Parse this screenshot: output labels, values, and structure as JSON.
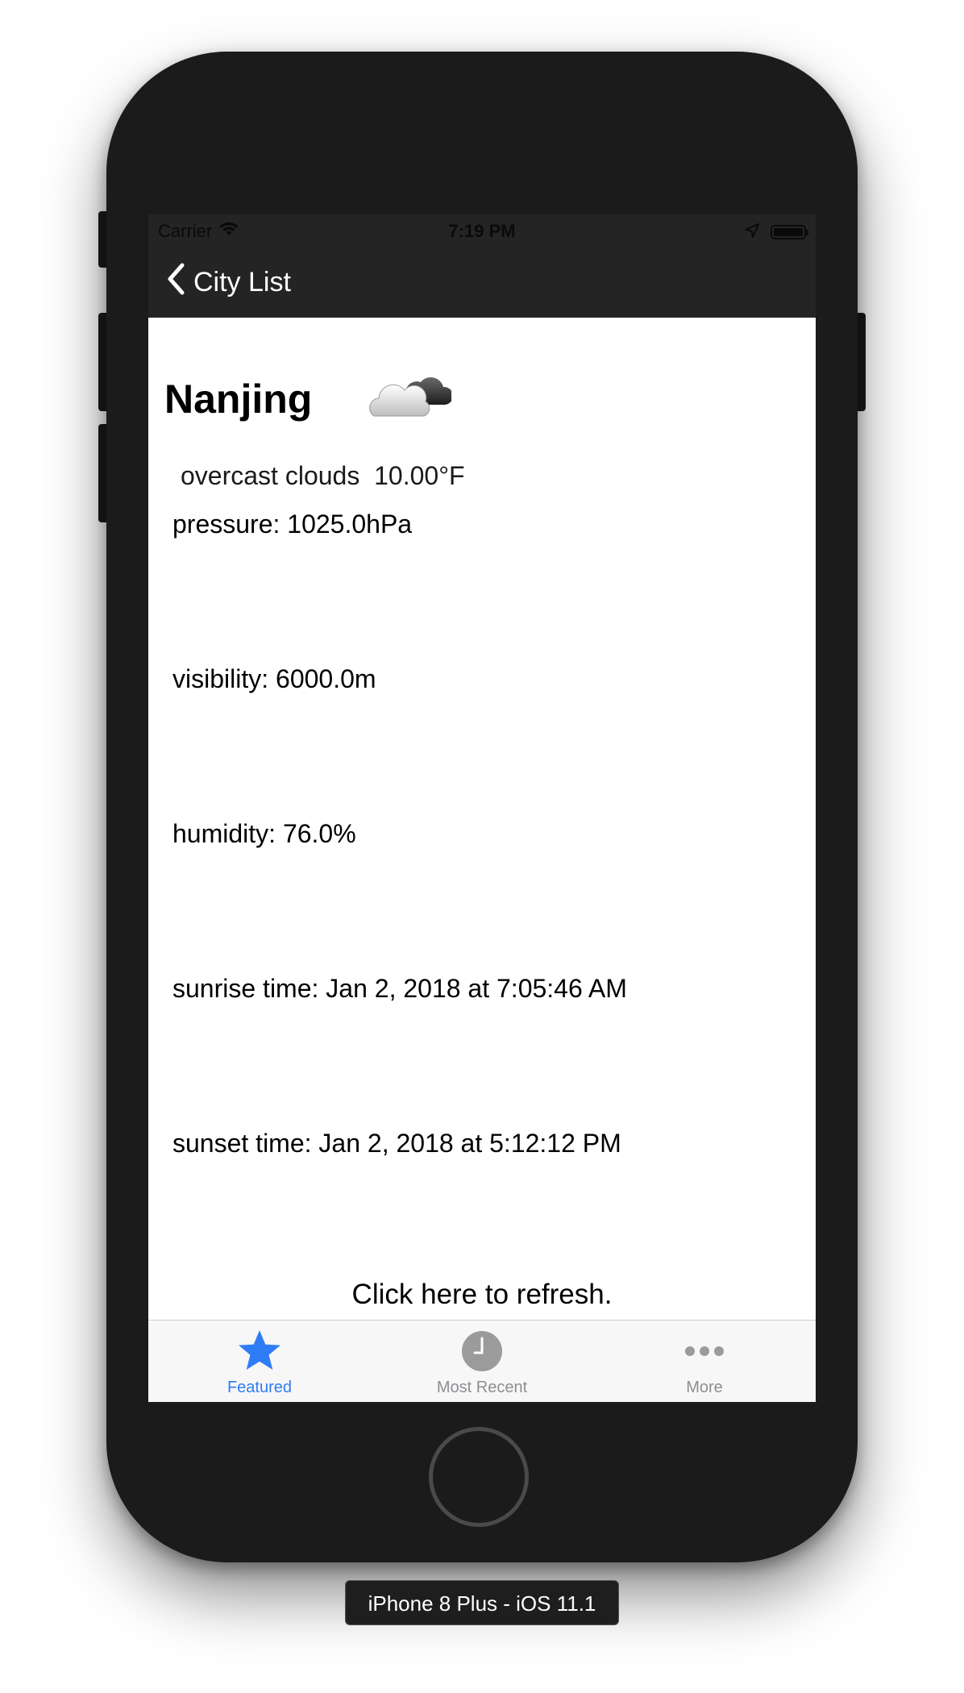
{
  "status_bar": {
    "carrier": "Carrier",
    "time": "7:19 PM",
    "icons": [
      "wifi-icon",
      "location-arrow-icon",
      "battery-icon"
    ]
  },
  "nav": {
    "back_label": "City List",
    "back_icon": "chevron-left-icon"
  },
  "weather": {
    "city": "Nanjing",
    "icon": "cloud-icon",
    "description": "overcast clouds",
    "temperature": "10.00°F",
    "pressure": "pressure: 1025.0hPa",
    "visibility": "visibility: 6000.0m",
    "humidity": "humidity: 76.0%",
    "sunrise": "sunrise time: Jan 2, 2018 at 7:05:46 AM",
    "sunset": "sunset time: Jan 2, 2018 at 5:12:12 PM"
  },
  "refresh_label": "Click here to refresh.",
  "tabs": [
    {
      "label": "Featured",
      "icon": "star-icon",
      "active": true
    },
    {
      "label": "Most Recent",
      "icon": "clock-icon",
      "active": false
    },
    {
      "label": "More",
      "icon": "more-icon",
      "active": false
    }
  ],
  "colors": {
    "accent": "#2f7cf6",
    "tab_inactive": "#8e8e93",
    "nav_background": "#242424",
    "device_body": "#1b1b1b"
  },
  "device_label": "iPhone 8 Plus - iOS 11.1"
}
